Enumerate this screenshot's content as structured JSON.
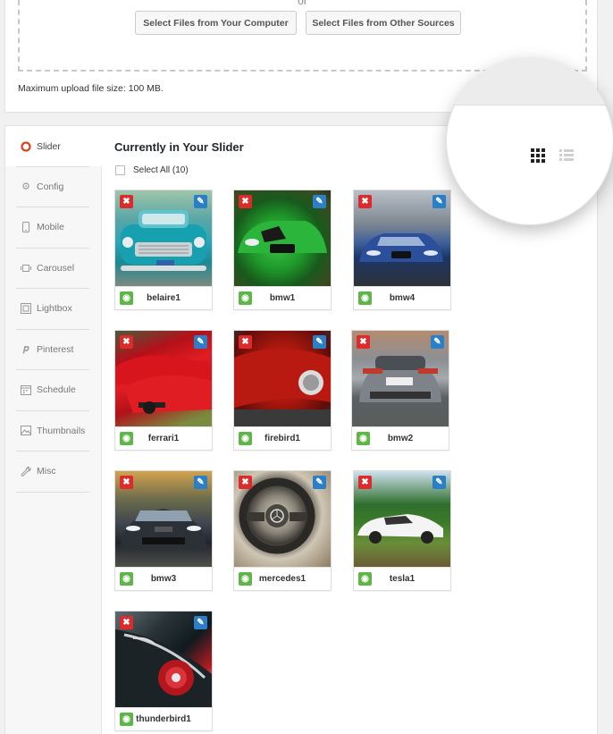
{
  "upload": {
    "or_text": "or",
    "btn_computer": "Select Files from Your Computer",
    "btn_other": "Select Files from Other Sources",
    "max_size": "Maximum upload file size: 100 MB."
  },
  "tabs": [
    {
      "label": "Slider",
      "icon": "lifering-icon",
      "active": true
    },
    {
      "label": "Config",
      "icon": "gear-icon"
    },
    {
      "label": "Mobile",
      "icon": "mobile-icon"
    },
    {
      "label": "Carousel",
      "icon": "carousel-icon"
    },
    {
      "label": "Lightbox",
      "icon": "lightbox-icon"
    },
    {
      "label": "Pinterest",
      "icon": "pinterest-icon"
    },
    {
      "label": "Schedule",
      "icon": "calendar-icon"
    },
    {
      "label": "Thumbnails",
      "icon": "image-icon"
    },
    {
      "label": "Misc",
      "icon": "wrench-icon"
    }
  ],
  "main": {
    "title": "Currently in Your Slider",
    "select_all": "Select All (10)"
  },
  "images": [
    {
      "name": "belaire1"
    },
    {
      "name": "bmw1"
    },
    {
      "name": "bmw4"
    },
    {
      "name": "ferrari1"
    },
    {
      "name": "firebird1"
    },
    {
      "name": "bmw2"
    },
    {
      "name": "bmw3"
    },
    {
      "name": "mercedes1"
    },
    {
      "name": "tesla1"
    },
    {
      "name": "thunderbird1"
    }
  ],
  "view_toggle": {
    "active": "grid"
  },
  "colors": {
    "delete": "#dd2a2a",
    "edit": "#2a7fc6",
    "view": "#5fb548",
    "active_tab_icon": "#e2401c"
  }
}
